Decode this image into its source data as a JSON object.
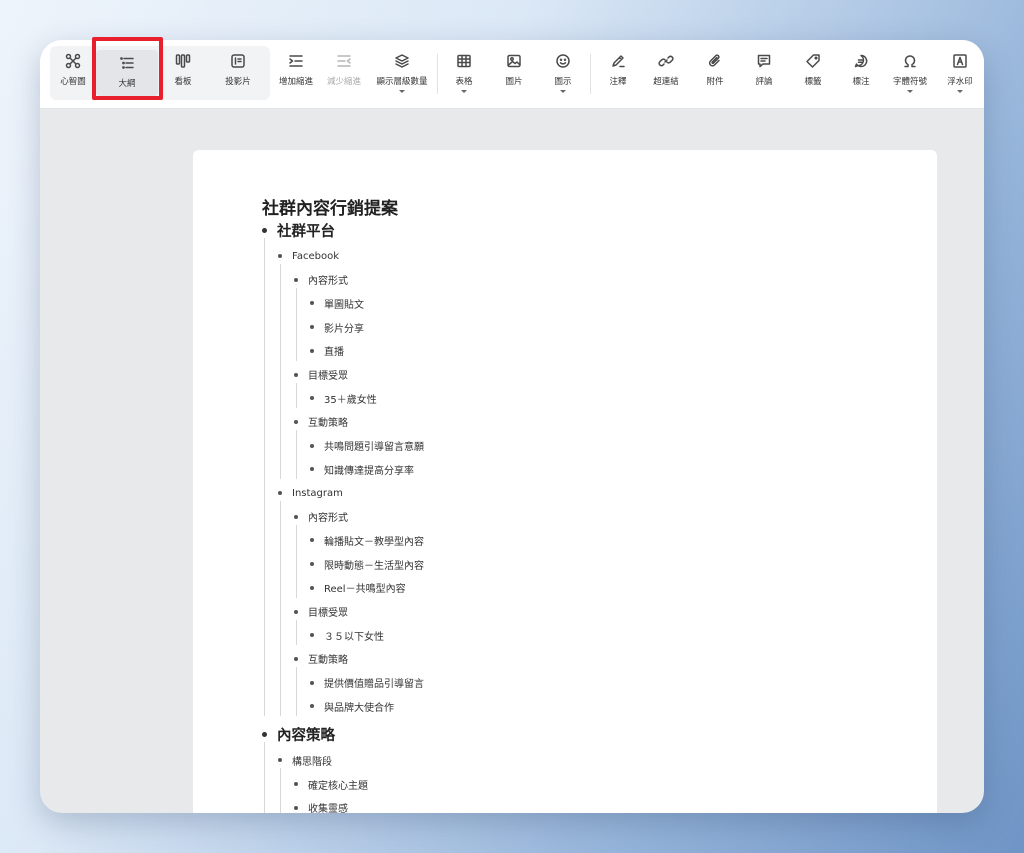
{
  "toolbar": {
    "view_modes": [
      {
        "label": "心智圖",
        "icon": "mindmap-icon"
      },
      {
        "label": "大綱",
        "icon": "outline-list-icon",
        "active": true
      },
      {
        "label": "看板",
        "icon": "kanban-icon"
      },
      {
        "label": "投影片",
        "icon": "slides-icon"
      }
    ],
    "indent_increase": "增加縮進",
    "indent_decrease": "減少縮進",
    "show_levels": "顯示層級數量",
    "table": "表格",
    "image": "圖片",
    "icon": "圖示",
    "annotation": "注釋",
    "hyperlink": "超連結",
    "attachment": "附件",
    "comment": "評論",
    "label": "標籤",
    "note": "標注",
    "symbols": "字體符號",
    "watermark": "浮水印"
  },
  "colors": {
    "highlight_border": "#e8202e"
  },
  "document": {
    "title": "社群內容行銷提案",
    "outline": [
      {
        "level": 0,
        "text": "社群平台"
      },
      {
        "level": 1,
        "text": "Facebook"
      },
      {
        "level": 2,
        "text": "內容形式"
      },
      {
        "level": 3,
        "text": "單圖貼文"
      },
      {
        "level": 3,
        "text": "影片分享"
      },
      {
        "level": 3,
        "text": "直播"
      },
      {
        "level": 2,
        "text": "目標受眾"
      },
      {
        "level": 3,
        "text": "35＋歲女性"
      },
      {
        "level": 2,
        "text": "互動策略"
      },
      {
        "level": 3,
        "text": "共鳴問題引導留言意願"
      },
      {
        "level": 3,
        "text": "知識傳達提高分享率"
      },
      {
        "level": 1,
        "text": "Instagram"
      },
      {
        "level": 2,
        "text": "內容形式"
      },
      {
        "level": 3,
        "text": "輪播貼文－教學型內容"
      },
      {
        "level": 3,
        "text": "限時動態－生活型內容"
      },
      {
        "level": 3,
        "text": "Reel－共鳴型內容"
      },
      {
        "level": 2,
        "text": "目標受眾"
      },
      {
        "level": 3,
        "text": "３５以下女性"
      },
      {
        "level": 2,
        "text": "互動策略"
      },
      {
        "level": 3,
        "text": "提供價值贈品引導留言"
      },
      {
        "level": 3,
        "text": "與品牌大使合作"
      },
      {
        "level": 0,
        "text": "內容策略"
      },
      {
        "level": 1,
        "text": "構思階段"
      },
      {
        "level": 2,
        "text": "確定核心主題"
      },
      {
        "level": 2,
        "text": "收集靈感"
      }
    ]
  }
}
